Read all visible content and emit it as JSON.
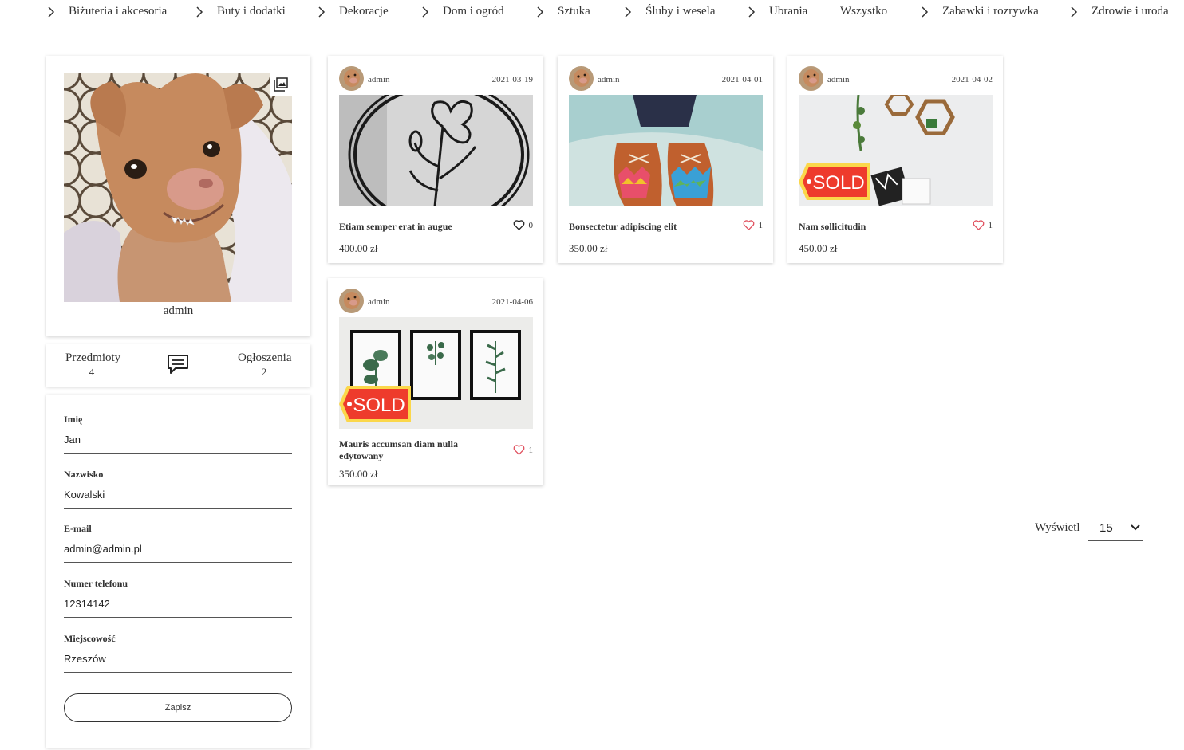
{
  "nav": {
    "categories": [
      {
        "label": "Biżuteria i akcesoria",
        "chevron": true
      },
      {
        "label": "Buty i dodatki",
        "chevron": true
      },
      {
        "label": "Dekoracje",
        "chevron": true
      },
      {
        "label": "Dom i ogród",
        "chevron": true
      },
      {
        "label": "Sztuka",
        "chevron": true
      },
      {
        "label": "Śluby i wesela",
        "chevron": true
      },
      {
        "label": "Ubrania",
        "chevron": true
      },
      {
        "label": "Wszystko",
        "chevron": false
      },
      {
        "label": "Zabawki i rozrywka",
        "chevron": true
      },
      {
        "label": "Zdrowie i uroda",
        "chevron": true
      }
    ]
  },
  "profile": {
    "username": "admin",
    "photo_icon": "image-icon"
  },
  "stats": {
    "items_label": "Przedmioty",
    "items_count": "4",
    "ads_label": "Ogłoszenia",
    "ads_count": "2",
    "message_icon": "chat-bubble-icon"
  },
  "form": {
    "first_name_label": "Imię",
    "first_name_value": "Jan",
    "last_name_label": "Nazwisko",
    "last_name_value": "Kowalski",
    "email_label": "E-mail",
    "email_value": "admin@admin.pl",
    "phone_label": "Numer telefonu",
    "phone_value": "12314142",
    "city_label": "Miejscowość",
    "city_value": "Rzeszów",
    "save_label": "Zapisz"
  },
  "products": [
    {
      "author": "admin",
      "date": "2021-03-19",
      "title": "Etiam semper erat in augue",
      "likes": "0",
      "liked": false,
      "price": "400.00 zł",
      "sold": false,
      "image": "floral-metal-wall-art"
    },
    {
      "author": "admin",
      "date": "2021-04-01",
      "title": "Bonsectetur adipiscing elit",
      "likes": "1",
      "liked": true,
      "price": "350.00 zł",
      "sold": false,
      "image": "patchwork-shoes"
    },
    {
      "author": "admin",
      "date": "2021-04-02",
      "title": "Nam sollicitudin",
      "likes": "1",
      "liked": true,
      "price": "450.00 zł",
      "sold": true,
      "sold_text": "SOLD",
      "image": "hexagon-shelves"
    },
    {
      "author": "admin",
      "date": "2021-04-06",
      "title": "Mauris accumsan diam nulla edytowany",
      "likes": "1",
      "liked": true,
      "price": "350.00 zł",
      "sold": true,
      "sold_text": "SOLD",
      "image": "botanical-frames"
    }
  ],
  "display": {
    "label": "Wyświetl",
    "selected": "15"
  },
  "colors": {
    "heart_liked": "#e0505e",
    "sold_red": "#ee3b2c",
    "sold_yellow": "#fbd74a"
  }
}
